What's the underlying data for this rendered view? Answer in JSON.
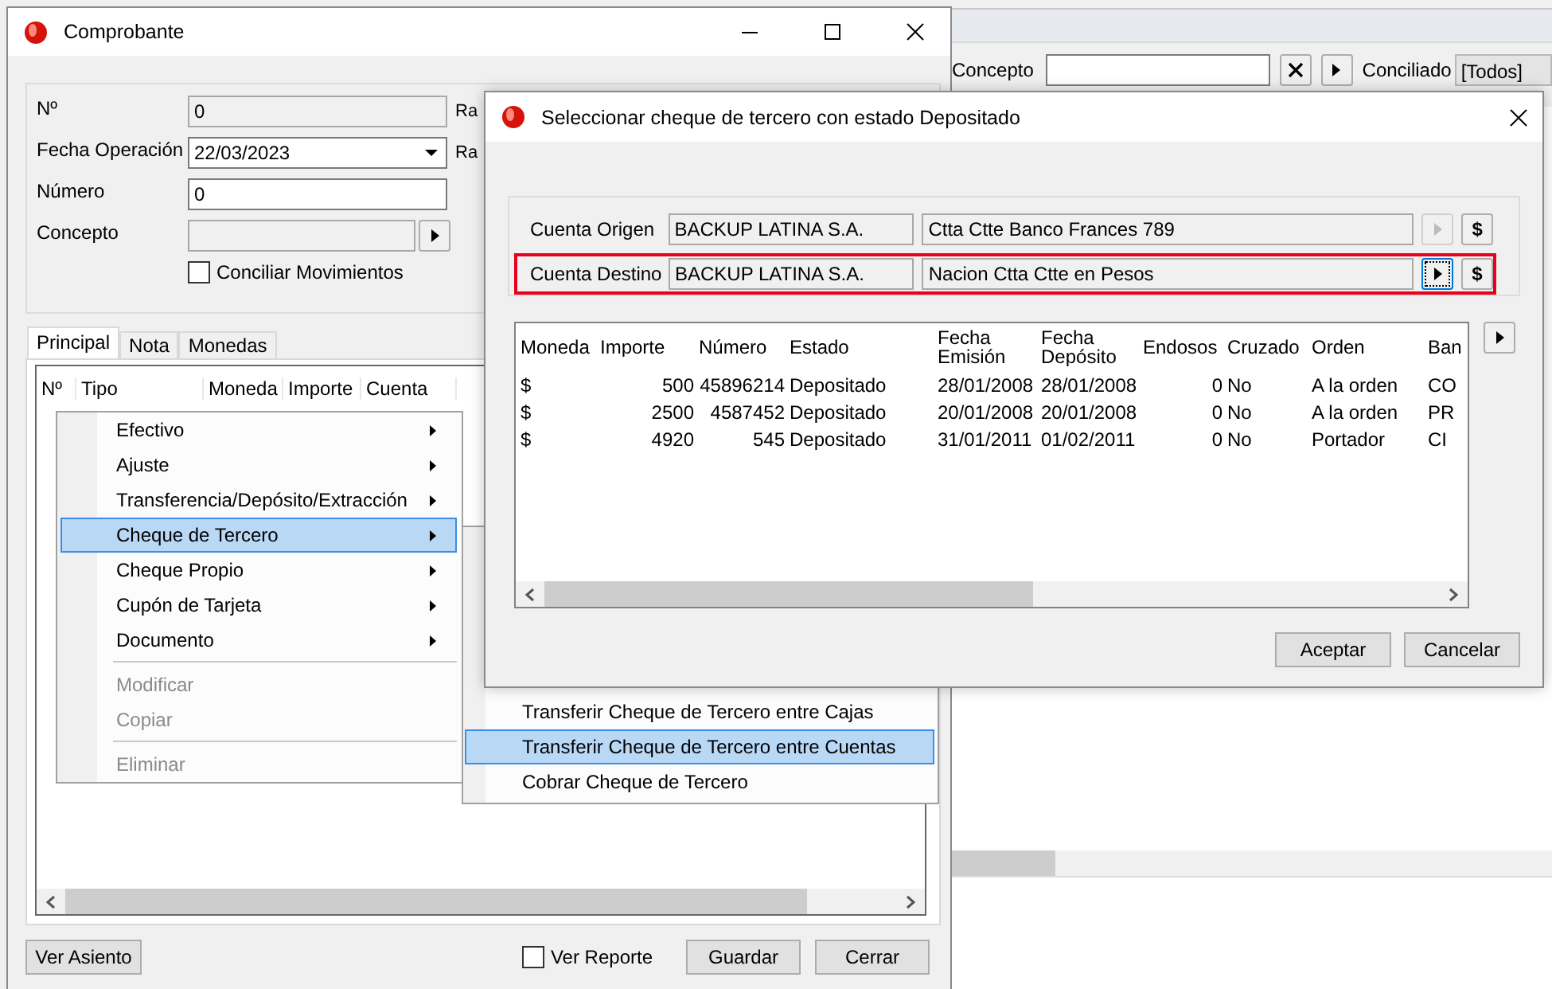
{
  "background_window": {
    "concepto_label": "Concepto",
    "conciliado_label": "Conciliado",
    "conciliado_value": "[Todos]"
  },
  "comprobante": {
    "title": "Comprobante",
    "fields": [
      {
        "label": "Nº",
        "kind": "readonly",
        "value": "0"
      },
      {
        "label": "Fecha Operación",
        "kind": "date",
        "value": "22/03/2023"
      },
      {
        "label": "Número",
        "kind": "text",
        "value": "0"
      },
      {
        "label": "Concepto",
        "kind": "lookup"
      }
    ],
    "side_labels": [
      "Ra",
      "Ra"
    ],
    "conciliar": {
      "label": "Conciliar Movimientos",
      "checked": false
    },
    "tabs": [
      {
        "label": "Principal",
        "selected": true
      },
      {
        "label": "Nota",
        "selected": false
      },
      {
        "label": "Monedas",
        "selected": false
      }
    ],
    "grid_columns": [
      "Nº",
      "Tipo",
      "Moneda",
      "Importe",
      "Cuenta"
    ],
    "ver_asiento": "Ver Asiento",
    "ver_reporte": {
      "label": "Ver Reporte",
      "checked": false
    },
    "buttons": [
      "Guardar",
      "Cerrar"
    ]
  },
  "context_menu": {
    "items": [
      {
        "label": "Efectivo",
        "has_submenu": true,
        "selected": false,
        "disabled": false,
        "separator_before": false
      },
      {
        "label": "Ajuste",
        "has_submenu": true,
        "selected": false,
        "disabled": false,
        "separator_before": false
      },
      {
        "label": "Transferencia/Depósito/Extracción",
        "has_submenu": true,
        "selected": false,
        "disabled": false,
        "separator_before": false
      },
      {
        "label": "Cheque de Tercero",
        "has_submenu": true,
        "selected": true,
        "disabled": false,
        "separator_before": false
      },
      {
        "label": "Cheque Propio",
        "has_submenu": true,
        "selected": false,
        "disabled": false,
        "separator_before": false
      },
      {
        "label": "Cupón de Tarjeta",
        "has_submenu": true,
        "selected": false,
        "disabled": false,
        "separator_before": false
      },
      {
        "label": "Documento",
        "has_submenu": true,
        "selected": false,
        "disabled": false,
        "separator_before": false
      },
      {
        "label": "Modificar",
        "has_submenu": false,
        "selected": false,
        "disabled": true,
        "separator_before": true
      },
      {
        "label": "Copiar",
        "has_submenu": false,
        "selected": false,
        "disabled": true,
        "separator_before": false
      },
      {
        "label": "Eliminar",
        "has_submenu": false,
        "selected": false,
        "disabled": true,
        "separator_before": true
      }
    ]
  },
  "submenu": {
    "items": [
      {
        "label": "Transferir Cheque de Tercero entre Cajas",
        "selected": false
      },
      {
        "label": "Transferir Cheque de Tercero entre Cuentas",
        "selected": true
      },
      {
        "label": "Cobrar Cheque de Tercero",
        "selected": false
      }
    ]
  },
  "dialog": {
    "title": "Seleccionar cheque de tercero con estado Depositado",
    "accounts": [
      {
        "label": "Cuenta Origen",
        "owner": "BACKUP LATINA S.A.",
        "account": "Ctta Ctte Banco Frances 789",
        "currency": "$",
        "highlighted": false,
        "disabled": true,
        "focused": false
      },
      {
        "label": "Cuenta Destino",
        "owner": "BACKUP LATINA S.A.",
        "account": "Nacion Ctta Ctte en Pesos",
        "currency": "$",
        "highlighted": true,
        "disabled": false,
        "focused": true
      }
    ],
    "columns": [
      "Moneda",
      "Importe",
      "Número",
      "Estado",
      "Fecha Emisión",
      "Fecha Depósito",
      "Endosos",
      "Cruzado",
      "Orden",
      "Ban"
    ],
    "rows": [
      [
        "$",
        "500",
        "45896214",
        "Depositado",
        "28/01/2008",
        "28/01/2008",
        "0",
        "No",
        "A la orden",
        "CO"
      ],
      [
        "$",
        "2500",
        "4587452",
        "Depositado",
        "20/01/2008",
        "20/01/2008",
        "0",
        "No",
        "A la orden",
        "PR"
      ],
      [
        "$",
        "4920",
        "545",
        "Depositado",
        "31/01/2011",
        "01/02/2011",
        "0",
        "No",
        "Portador",
        "CI"
      ]
    ],
    "buttons": [
      "Aceptar",
      "Cancelar"
    ]
  }
}
